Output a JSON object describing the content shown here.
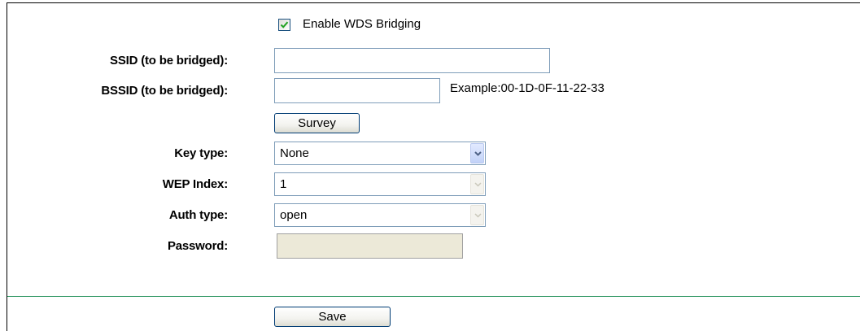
{
  "wds": {
    "enable_label": "Enable WDS Bridging",
    "enabled": true
  },
  "fields": {
    "ssid_label": "SSID (to be bridged):",
    "ssid_value": "",
    "bssid_label": "BSSID (to be bridged):",
    "bssid_value": "",
    "bssid_example": "Example:00-1D-0F-11-22-33",
    "survey_label": "Survey",
    "key_type_label": "Key type:",
    "key_type_value": "None",
    "wep_index_label": "WEP Index:",
    "wep_index_value": "1",
    "auth_type_label": "Auth type:",
    "auth_type_value": "open",
    "password_label": "Password:",
    "password_value": ""
  },
  "actions": {
    "save_label": "Save"
  },
  "colors": {
    "separator": "#339966",
    "checkmark": "#21a121",
    "dropdown_arrow": "#4d6185"
  },
  "icons": {
    "checkbox": "checkmark-icon",
    "dropdown": "chevron-down-icon"
  }
}
